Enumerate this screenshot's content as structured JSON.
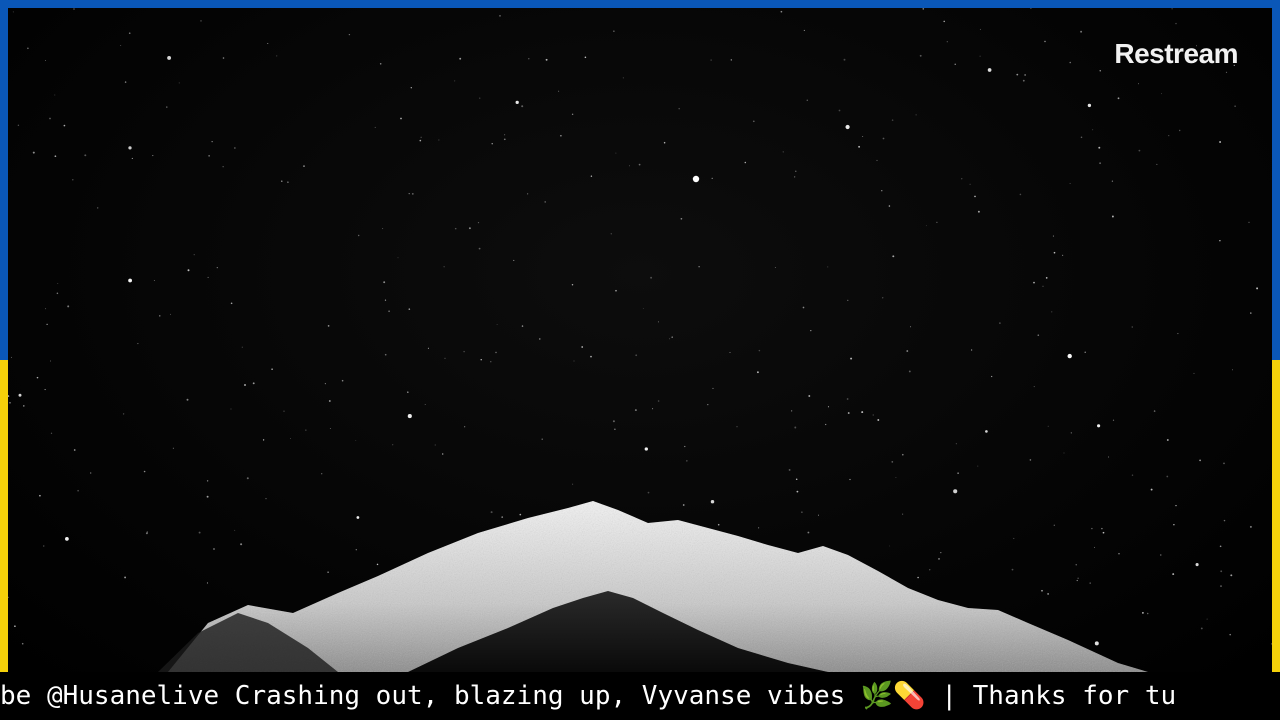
{
  "brand": {
    "name": "Restream"
  },
  "ticker": {
    "text": "be @Husanelive Crashing out, blazing up, Vyvanse vibes 🌿💊 | Thanks for tu"
  },
  "colors": {
    "border_blue": "#0a57b8",
    "border_yellow": "#f5d10a",
    "sky": "#000000",
    "mountain_snow": "#e6e6e6"
  },
  "background": {
    "icon": "night-sky-mountain"
  }
}
